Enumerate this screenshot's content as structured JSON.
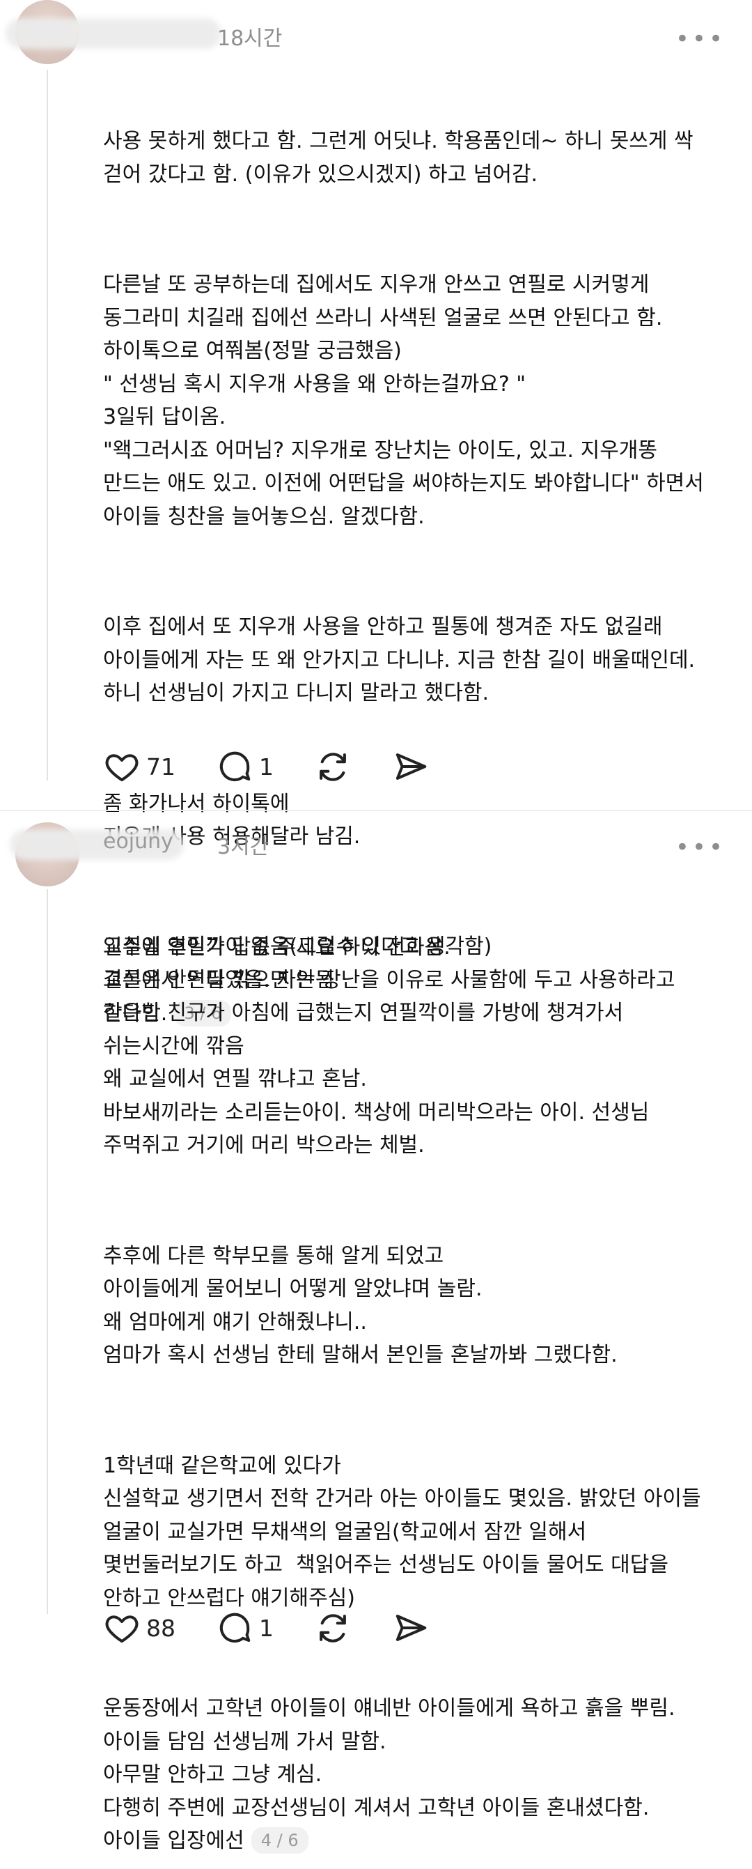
{
  "posts": [
    {
      "username": "",
      "time": "18시간",
      "more": "•••",
      "paragraphs": [
        [
          "사용 못하게 했다고 함. 그런게 어딧냐. 학용품인데~ 하니 못쓰게 싹",
          "걷어 갔다고 함. (이유가 있으시겠지) 하고 넘어감."
        ],
        [
          "다른날 또 공부하는데 집에서도 지우개 안쓰고 연필로 시커멓게",
          "동그라미 치길래 집에선 쓰라니 사색된 얼굴로 쓰면 안된다고 함.",
          "하이톡으로 여쭤봄(정말 궁금했음)",
          "\" 선생님 혹시 지우개 사용을 왜 안하는걸까요? \"",
          "3일뒤 답이옴.",
          "\"왝그러시죠 어머님? 지우개로 장난치는 아이도, 있고. 지우개똥",
          "만드는 애도 있고. 이전에 어떤답을 써야하는지도 봐야합니다\" 하면서",
          "아이들 칭찬을 늘어놓으심. 알겠다함."
        ],
        [
          "이후 집에서 또 지우개 사용을 안하고 필통에 챙겨준 자도 없길래",
          "아이들에게 자는 또 왜 안가지고 다니냐. 지금 한참 길이 배울때인데.",
          "하니 선생님이 가지고 다니지 말라고 했다함."
        ],
        [
          "좀 화가나서 하이톡에",
          "지우개 사용 허용해달라 남김."
        ],
        [
          "일주일 후인가 답좀 주세요 하니 전화옴.",
          "결론은 안된다였음. 자는 장난을 이유로 사물함에 두고 사용하라고",
          "한다함."
        ]
      ],
      "pager": "3 / 6",
      "likes": "71",
      "replies": "1"
    },
    {
      "username": "eojuny",
      "time": "3시간",
      "more": "•••",
      "paragraphs": [
        [
          "교실에 연필깍이 없음(그럴수 있다고 생각함)",
          "교실에서 연필 깎으면 안됨",
          "같은반 친구가 아침에 급했는지 연필깍이를 가방에 챙겨가서",
          "쉬는시간에 깎음",
          "왜 교실에서 연필 깎냐고 혼남.",
          "바보새끼라는 소리듣는아이. 책상에 머리박으라는 아이. 선생님",
          "주먹쥐고 거기에 머리 박으라는 체벌."
        ],
        [
          "추후에 다른 학부모를 통해 알게 되었고",
          "아이들에게 물어보니 어떻게 알았냐며 놀람.",
          "왜 엄마에게 얘기 안해줬냐니..",
          "엄마가 혹시 선생님 한테 말해서 본인들 혼날까봐 그랬다함."
        ],
        [
          "1학년때 같은학교에 있다가",
          "신설학교 생기면서 전학 간거라 아는 아이들도 몇있음. 밝았던 아이들",
          "얼굴이 교실가면 무채색의 얼굴임(학교에서 잠깐 일해서",
          "몇번둘러보기도 하고  책읽어주는 선생님도 아이들 물어도 대답을",
          "안하고 안쓰럽다 얘기해주심)"
        ],
        [
          "운동장에서 고학년 아이들이 얘네반 아이들에게 욕하고 흙을 뿌림.",
          "아이들 담임 선생님께 가서 말함.",
          "아무말 안하고 그냥 계심.",
          "다행히 주변에 교장선생님이 계셔서 고학년 아이들 혼내셨다함.",
          "아이들 입장에선"
        ]
      ],
      "pager": "4 / 6",
      "likes": "88",
      "replies": "1"
    }
  ],
  "icons": {
    "like": "heart-icon",
    "reply": "comment-icon",
    "repost": "repost-icon",
    "share": "send-icon"
  }
}
